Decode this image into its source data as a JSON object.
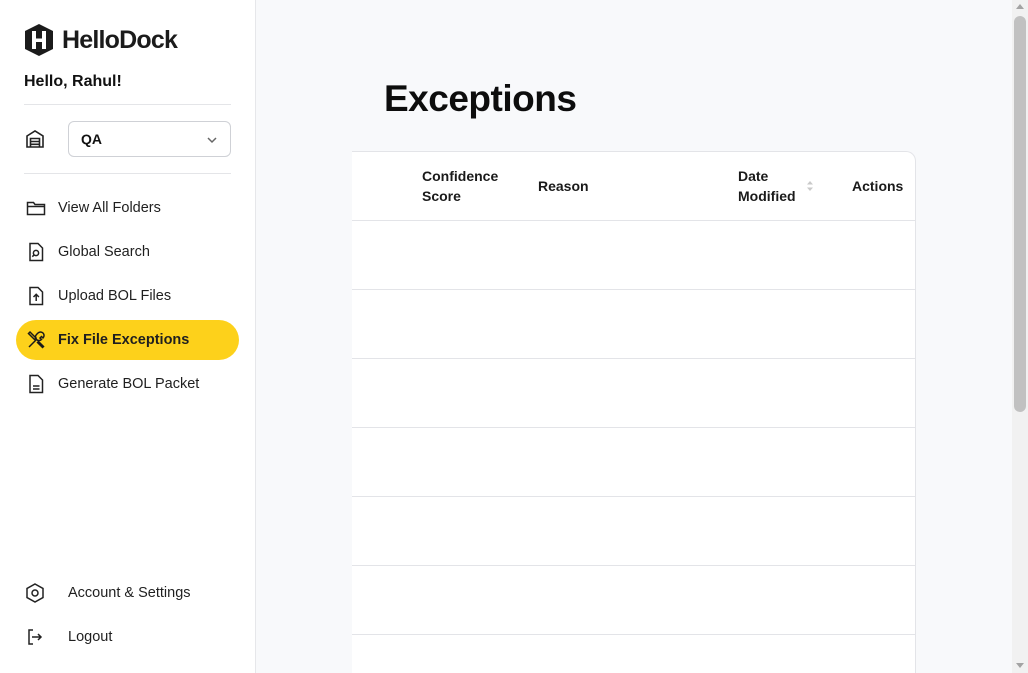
{
  "brand": {
    "name": "HelloDock",
    "icon": "hellodock-logo-icon"
  },
  "greeting": "Hello, Rahul!",
  "warehouse_select": {
    "icon": "warehouse-icon",
    "value": "QA"
  },
  "nav": {
    "items": [
      {
        "label": "View All Folders",
        "icon": "folder-icon",
        "active": false
      },
      {
        "label": "Global Search",
        "icon": "file-search-icon",
        "active": false
      },
      {
        "label": "Upload BOL Files",
        "icon": "file-upload-icon",
        "active": false
      },
      {
        "label": "Fix File Exceptions",
        "icon": "tools-icon",
        "active": true
      },
      {
        "label": "Generate BOL Packet",
        "icon": "file-text-icon",
        "active": false
      }
    ],
    "bottom": [
      {
        "label": "Account & Settings",
        "icon": "gear-icon"
      },
      {
        "label": "Logout",
        "icon": "logout-icon"
      }
    ]
  },
  "page": {
    "title": "Exceptions"
  },
  "table": {
    "columns": [
      "Confidence Score",
      "Reason",
      "Date Modified",
      "Actions"
    ],
    "sortable_column": "Date Modified",
    "row_count_visible": 7
  },
  "colors": {
    "accent": "#fdd11b",
    "background": "#f8f9fb",
    "sidebar": "#ffffff"
  }
}
